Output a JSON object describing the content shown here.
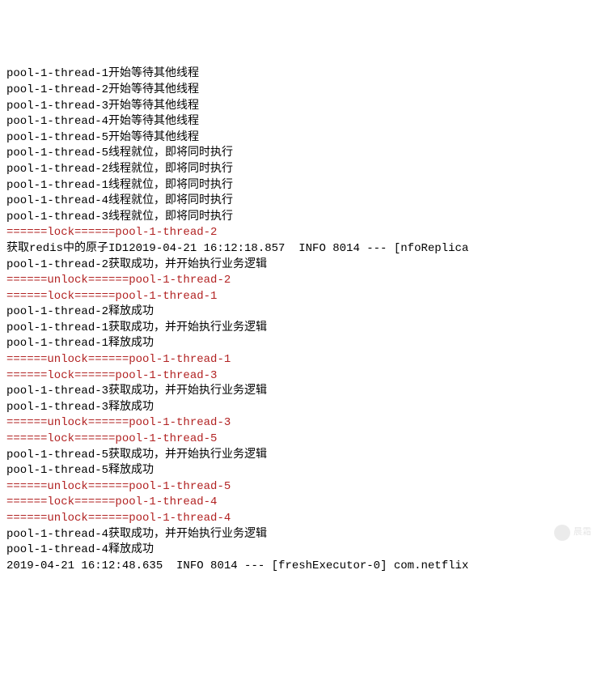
{
  "lines": [
    {
      "color": "black",
      "text": "pool-1-thread-1开始等待其他线程"
    },
    {
      "color": "black",
      "text": "pool-1-thread-2开始等待其他线程"
    },
    {
      "color": "black",
      "text": "pool-1-thread-3开始等待其他线程"
    },
    {
      "color": "black",
      "text": "pool-1-thread-4开始等待其他线程"
    },
    {
      "color": "black",
      "text": "pool-1-thread-5开始等待其他线程"
    },
    {
      "color": "black",
      "text": "pool-1-thread-5线程就位，即将同时执行"
    },
    {
      "color": "black",
      "text": "pool-1-thread-2线程就位，即将同时执行"
    },
    {
      "color": "black",
      "text": "pool-1-thread-1线程就位，即将同时执行"
    },
    {
      "color": "black",
      "text": "pool-1-thread-4线程就位，即将同时执行"
    },
    {
      "color": "black",
      "text": "pool-1-thread-3线程就位，即将同时执行"
    },
    {
      "color": "red",
      "text": "======lock======pool-1-thread-2"
    },
    {
      "color": "black",
      "text": "获取redis中的原子ID12019-04-21 16:12:18.857  INFO 8014 --- [nfoReplica"
    },
    {
      "color": "black",
      "text": "pool-1-thread-2获取成功，并开始执行业务逻辑"
    },
    {
      "color": "red",
      "text": "======unlock======pool-1-thread-2"
    },
    {
      "color": "red",
      "text": "======lock======pool-1-thread-1"
    },
    {
      "color": "black",
      "text": "pool-1-thread-2释放成功"
    },
    {
      "color": "black",
      "text": "pool-1-thread-1获取成功，并开始执行业务逻辑"
    },
    {
      "color": "black",
      "text": "pool-1-thread-1释放成功"
    },
    {
      "color": "red",
      "text": "======unlock======pool-1-thread-1"
    },
    {
      "color": "red",
      "text": "======lock======pool-1-thread-3"
    },
    {
      "color": "black",
      "text": "pool-1-thread-3获取成功，并开始执行业务逻辑"
    },
    {
      "color": "black",
      "text": "pool-1-thread-3释放成功"
    },
    {
      "color": "red",
      "text": "======unlock======pool-1-thread-3"
    },
    {
      "color": "red",
      "text": "======lock======pool-1-thread-5"
    },
    {
      "color": "black",
      "text": "pool-1-thread-5获取成功，并开始执行业务逻辑"
    },
    {
      "color": "black",
      "text": "pool-1-thread-5释放成功"
    },
    {
      "color": "red",
      "text": "======unlock======pool-1-thread-5"
    },
    {
      "color": "red",
      "text": "======lock======pool-1-thread-4"
    },
    {
      "color": "red",
      "text": "======unlock======pool-1-thread-4"
    },
    {
      "color": "black",
      "text": "pool-1-thread-4获取成功，并开始执行业务逻辑"
    },
    {
      "color": "black",
      "text": "pool-1-thread-4释放成功"
    },
    {
      "color": "black",
      "text": "2019-04-21 16:12:48.635  INFO 8014 --- [freshExecutor-0] com.netflix"
    }
  ],
  "watermark": "晨霜"
}
